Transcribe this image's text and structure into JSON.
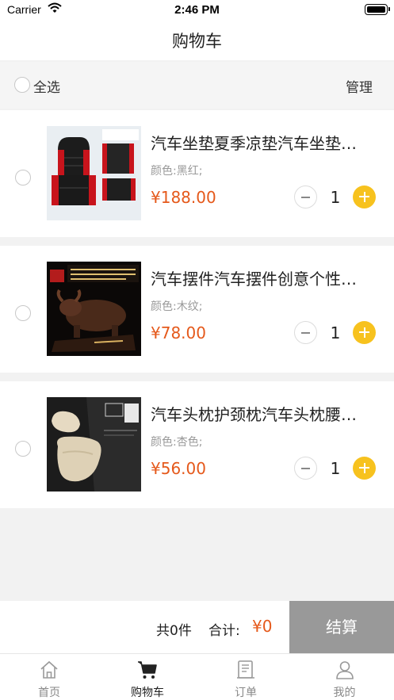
{
  "status_bar": {
    "carrier": "Carrier",
    "time": "2:46 PM"
  },
  "nav": {
    "title": "购物车"
  },
  "toolbar": {
    "select_all": "全选",
    "manage": "管理"
  },
  "cart": {
    "items": [
      {
        "title": "汽车坐垫夏季凉垫汽车坐垫四季通用座垫",
        "spec": "颜色:黑红;",
        "price": "¥188.00",
        "qty": "1",
        "thumb_icon": "seat-cushion-image"
      },
      {
        "title": "汽车摆件汽车摆件创意个性车载摆件",
        "spec": "颜色:木纹;",
        "price": "¥78.00",
        "qty": "1",
        "thumb_icon": "bull-ornament-image"
      },
      {
        "title": "汽车头枕护颈枕汽车头枕腰靠套装",
        "spec": "颜色:杏色;",
        "price": "¥56.00",
        "qty": "1",
        "thumb_icon": "headrest-pillow-image"
      }
    ]
  },
  "checkout": {
    "count_text": "共0件",
    "total_label": "合计:",
    "total_value": "¥0",
    "button": "结算"
  },
  "tabs": [
    {
      "label": "首页",
      "icon": "home-icon",
      "active": false
    },
    {
      "label": "购物车",
      "icon": "cart-icon",
      "active": true
    },
    {
      "label": "订单",
      "icon": "order-icon",
      "active": false
    },
    {
      "label": "我的",
      "icon": "user-icon",
      "active": false
    }
  ],
  "colors": {
    "price": "#e5591b",
    "plus_button": "#f7c21e",
    "checkout_button": "#999999"
  }
}
